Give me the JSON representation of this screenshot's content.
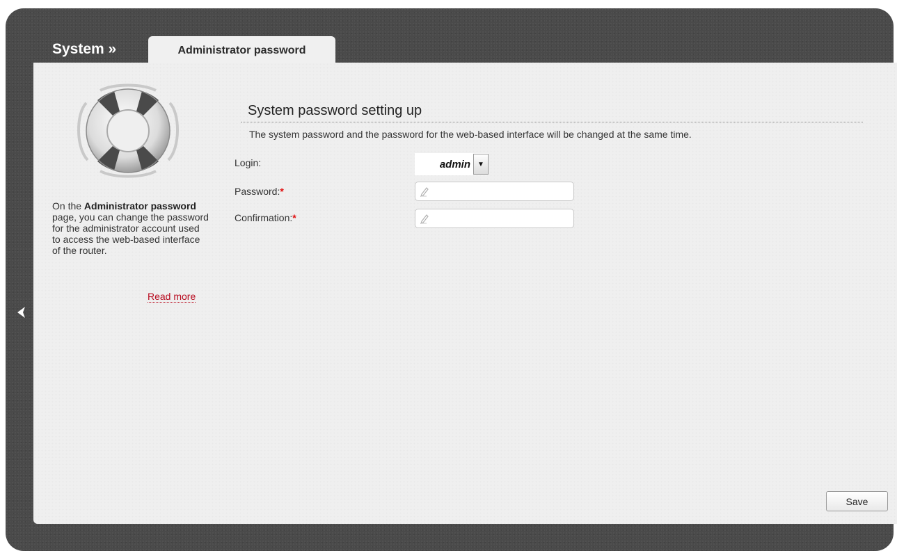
{
  "header": {
    "breadcrumb_root": "System »",
    "active_tab": "Administrator password"
  },
  "help": {
    "text_1": "On the ",
    "bold_1": "Administrator password",
    "text_2": " page, you can change the password for the administrator account used to access the web-based interface of the router.",
    "read_more": "Read more"
  },
  "section": {
    "title": "System password setting up",
    "description": "The system password and the password for the web-based interface will be changed at the same time."
  },
  "form": {
    "login_label": "Login:",
    "login_value": "admin",
    "password_label": "Password:",
    "confirmation_label": "Confirmation:",
    "required_mark": "*"
  },
  "actions": {
    "save_label": "Save"
  },
  "colors": {
    "accent_red": "#b80b1f",
    "frame_dark": "#4a4a4a"
  },
  "icons": [
    "back-arrow-icon",
    "lifebuoy-icon",
    "pencil-icon",
    "chevron-down-icon"
  ]
}
